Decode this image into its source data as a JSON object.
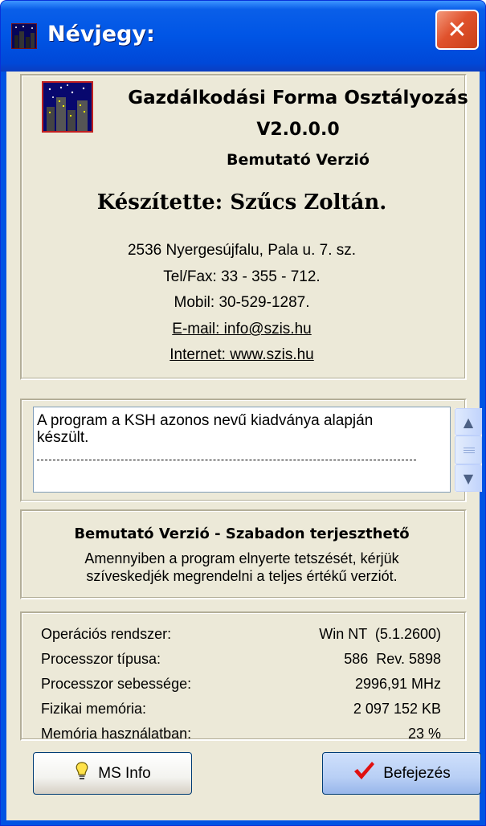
{
  "window": {
    "title": "Névjegy:",
    "close_glyph": "✕"
  },
  "about": {
    "app_name": "Gazdálkodási Forma Osztályozás",
    "version": "V2.0.0.0",
    "edition": "Bemutató Verzió",
    "author": "Készítette: Szűcs Zoltán.",
    "address": "2536 Nyergesújfalu, Pala u. 7. sz.",
    "telfax": "Tel/Fax: 33 - 355 - 712.",
    "mobile": "Mobil: 30-529-1287.",
    "email": "E-mail: info@szis.hu",
    "internet": "Internet: www.szis.hu"
  },
  "memo": {
    "text": "A program a KSH azonos nevű kiadványa alapján készült."
  },
  "notice": {
    "title": "Bemutató Verzió - Szabadon terjeszthető",
    "line1": "Amennyiben a program elnyerte tetszését, kérjük",
    "line2": "szíveskedjék megrendelni a teljes értékű verziót."
  },
  "system_info": [
    {
      "label": "Operációs rendszer:",
      "value": "Win NT  (5.1.2600)"
    },
    {
      "label": "Processzor típusa:",
      "value": "586  Rev. 5898"
    },
    {
      "label": "Processzor sebessége:",
      "value": "2996,91 MHz"
    },
    {
      "label": "Fizikai memória:",
      "value": "2 097 152 KB"
    },
    {
      "label": "Memória használatban:",
      "value": "23 %"
    }
  ],
  "buttons": {
    "msinfo": "MS Info",
    "finish": "Befejezés"
  },
  "icons": {
    "msinfo": "lightbulb-icon",
    "finish": "checkmark-icon",
    "app": "city-night-icon"
  },
  "colors": {
    "titlebar": "#0055e5",
    "dialog_bg": "#ece9d8",
    "close": "#e0512c",
    "checkmark": "#e01010"
  }
}
